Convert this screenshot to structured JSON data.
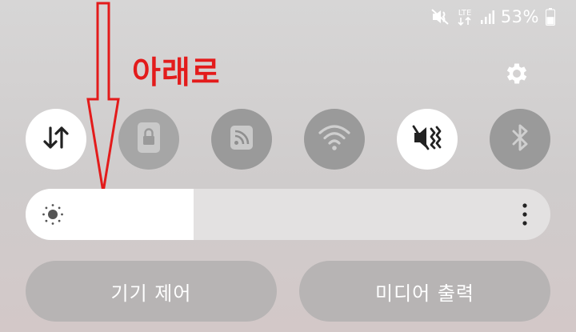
{
  "status_bar": {
    "network_type": "LTE",
    "battery_percent": "53%",
    "battery_level": 0.53,
    "icons": [
      "mute-vibrate-icon",
      "lte-data-icon",
      "signal-icon",
      "battery-icon"
    ]
  },
  "annotation": {
    "label": "아래로",
    "color": "#e31b1b",
    "direction": "down"
  },
  "quick_settings": {
    "settings_icon": "gear-icon",
    "toggles": [
      {
        "icon": "mobile-data-icon",
        "state": "on"
      },
      {
        "icon": "lock-icon",
        "state": "off"
      },
      {
        "icon": "cast-icon",
        "state": "off"
      },
      {
        "icon": "wifi-icon",
        "state": "off"
      },
      {
        "icon": "vibrate-mode-icon",
        "state": "on"
      },
      {
        "icon": "bluetooth-icon",
        "state": "off"
      }
    ]
  },
  "brightness": {
    "level": 0.32,
    "icon": "sun-icon",
    "more_icon": "more-vertical-icon"
  },
  "buttons": {
    "device_control": "기기 제어",
    "media_output": "미디어 출력"
  },
  "colors": {
    "toggle_on": "#ffffff",
    "toggle_off": "#9a9a9a",
    "accent_text": "#ffffff"
  }
}
